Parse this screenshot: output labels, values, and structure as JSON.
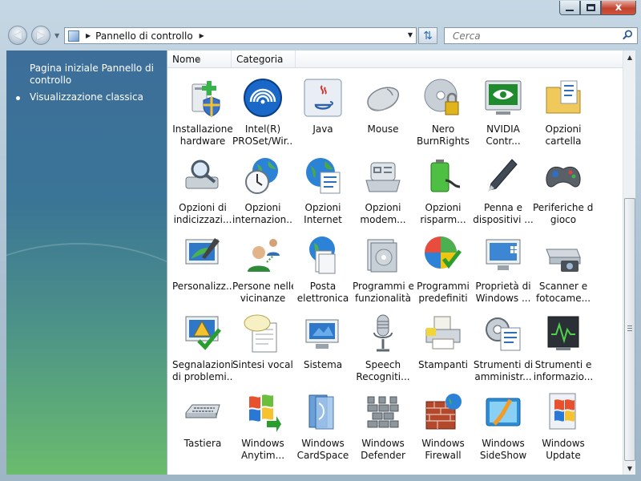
{
  "window": {
    "minimize_icon": "minimize-icon",
    "maximize_icon": "maximize-icon",
    "close_label": "x"
  },
  "nav": {
    "back_icon": "back-arrow-icon",
    "forward_icon": "forward-arrow-icon",
    "address_path": "Pannello di controllo",
    "search_placeholder": "Cerca"
  },
  "sidebar": {
    "home_link": "Pagina iniziale Pannello di controllo",
    "classic_view": "Visualizzazione classica"
  },
  "columns": [
    "Nome",
    "Categoria"
  ],
  "items": [
    {
      "line1": "Installazione",
      "line2": "hardware",
      "icon": "hardware-install-icon"
    },
    {
      "line1": "Intel(R)",
      "line2": "PROSet/Wir...",
      "icon": "intel-wireless-icon"
    },
    {
      "line1": "Java",
      "line2": "",
      "icon": "java-icon"
    },
    {
      "line1": "Mouse",
      "line2": "",
      "icon": "mouse-icon"
    },
    {
      "line1": "Nero",
      "line2": "BurnRights",
      "icon": "nero-burnrights-icon"
    },
    {
      "line1": "NVIDIA",
      "line2": "Contr...",
      "icon": "nvidia-icon"
    },
    {
      "line1": "Opzioni",
      "line2": "cartella",
      "icon": "folder-options-icon"
    },
    {
      "line1": "Opzioni di",
      "line2": "indicizzazi...",
      "icon": "indexing-options-icon"
    },
    {
      "line1": "Opzioni",
      "line2": "internazion...",
      "icon": "regional-options-icon"
    },
    {
      "line1": "Opzioni",
      "line2": "Internet",
      "icon": "internet-options-icon"
    },
    {
      "line1": "Opzioni",
      "line2": "modem...",
      "icon": "modem-options-icon"
    },
    {
      "line1": "Opzioni",
      "line2": "risparm...",
      "icon": "power-options-icon"
    },
    {
      "line1": "Penna e",
      "line2": "dispositivi ...",
      "icon": "pen-icon"
    },
    {
      "line1": "Periferiche di",
      "line2": "gioco",
      "icon": "gamepad-icon"
    },
    {
      "line1": "Personalizz...",
      "line2": "",
      "icon": "personalization-icon"
    },
    {
      "line1": "Persone nelle",
      "line2": "vicinanze",
      "icon": "people-near-me-icon"
    },
    {
      "line1": "Posta",
      "line2": "elettronica",
      "icon": "mail-icon"
    },
    {
      "line1": "Programmi e",
      "line2": "funzionalità",
      "icon": "programs-features-icon"
    },
    {
      "line1": "Programmi",
      "line2": "predefiniti",
      "icon": "default-programs-icon"
    },
    {
      "line1": "Proprietà di",
      "line2": "Windows ...",
      "icon": "windows-properties-icon"
    },
    {
      "line1": "Scanner e",
      "line2": "fotocame...",
      "icon": "scanner-camera-icon"
    },
    {
      "line1": "Segnalazioni",
      "line2": "di problemi...",
      "icon": "problem-reports-icon"
    },
    {
      "line1": "Sintesi vocale",
      "line2": "",
      "icon": "text-to-speech-icon"
    },
    {
      "line1": "Sistema",
      "line2": "",
      "icon": "system-icon"
    },
    {
      "line1": "Speech",
      "line2": "Recogniti...",
      "icon": "microphone-icon"
    },
    {
      "line1": "Stampanti",
      "line2": "",
      "icon": "printer-icon"
    },
    {
      "line1": "Strumenti di",
      "line2": "amministr...",
      "icon": "admin-tools-icon"
    },
    {
      "line1": "Strumenti e",
      "line2": "informazio...",
      "icon": "performance-icon"
    },
    {
      "line1": "Tastiera",
      "line2": "",
      "icon": "keyboard-icon"
    },
    {
      "line1": "Windows",
      "line2": "Anytim...",
      "icon": "windows-anytime-icon"
    },
    {
      "line1": "Windows",
      "line2": "CardSpace",
      "icon": "cardspace-icon"
    },
    {
      "line1": "Windows",
      "line2": "Defender",
      "icon": "defender-icon"
    },
    {
      "line1": "Windows",
      "line2": "Firewall",
      "icon": "firewall-icon"
    },
    {
      "line1": "Windows",
      "line2": "SideShow",
      "icon": "sideshow-icon"
    },
    {
      "line1": "Windows",
      "line2": "Update",
      "icon": "windows-update-icon"
    }
  ]
}
